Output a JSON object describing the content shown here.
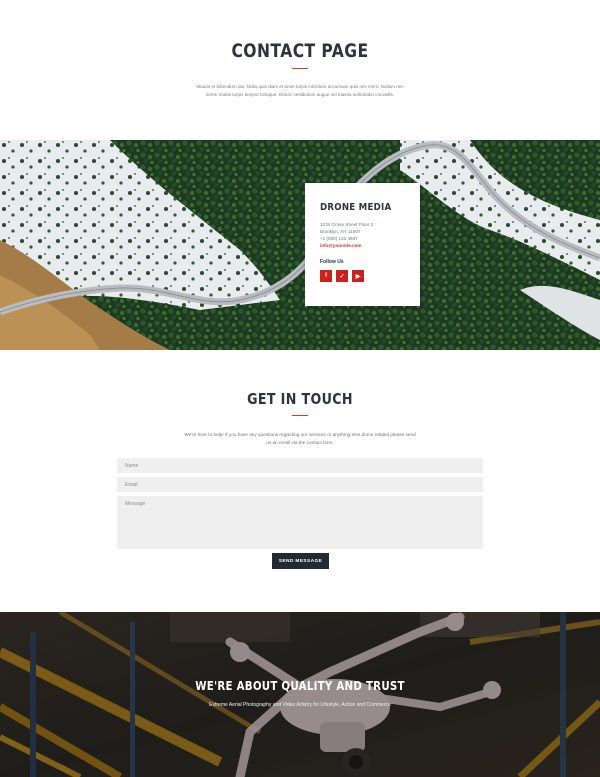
{
  "header": {
    "title": "CONTACT PAGE",
    "intro_line_1": "Mauris et bibendum dui. Nulla quis diam et amet turpis interdum accumsan quis nec enim. Nullam nec",
    "intro_line_2": "lorem mattis turpis tempor tristique. Donec vestibulum augue vel massa sollicitudin convallis."
  },
  "info_card": {
    "title": "DRONE MEDIA",
    "address_line_1": "1234 Grove Street Floor 3",
    "address_line_2": "Brooklyn, NY 11007",
    "phone": "+1 (000) 123 4567",
    "email": "info@yoursite.com",
    "follow_label": "Follow Us",
    "social": [
      {
        "icon": "facebook-icon",
        "glyph": "f"
      },
      {
        "icon": "twitter-icon",
        "glyph": "✓"
      },
      {
        "icon": "youtube-icon",
        "glyph": "▶"
      }
    ]
  },
  "contact": {
    "title": "GET IN TOUCH",
    "text_line_1": "We're here to help! If you have any questions regarding our services or anything else drone related please send",
    "text_line_2": "us an email via the contact form.",
    "name_placeholder": "Name",
    "email_placeholder": "Email",
    "message_placeholder": "Message",
    "send_label": "SEND MESSAGE"
  },
  "quality": {
    "title": "WE'RE ABOUT QUALITY AND TRUST",
    "subtitle": "Extreme Aerial Photography and Video Artistry for Lifestyle, Action and Commerce"
  },
  "colors": {
    "accent": "#cf2020",
    "dark": "#232a34",
    "field_bg": "#efefef"
  }
}
